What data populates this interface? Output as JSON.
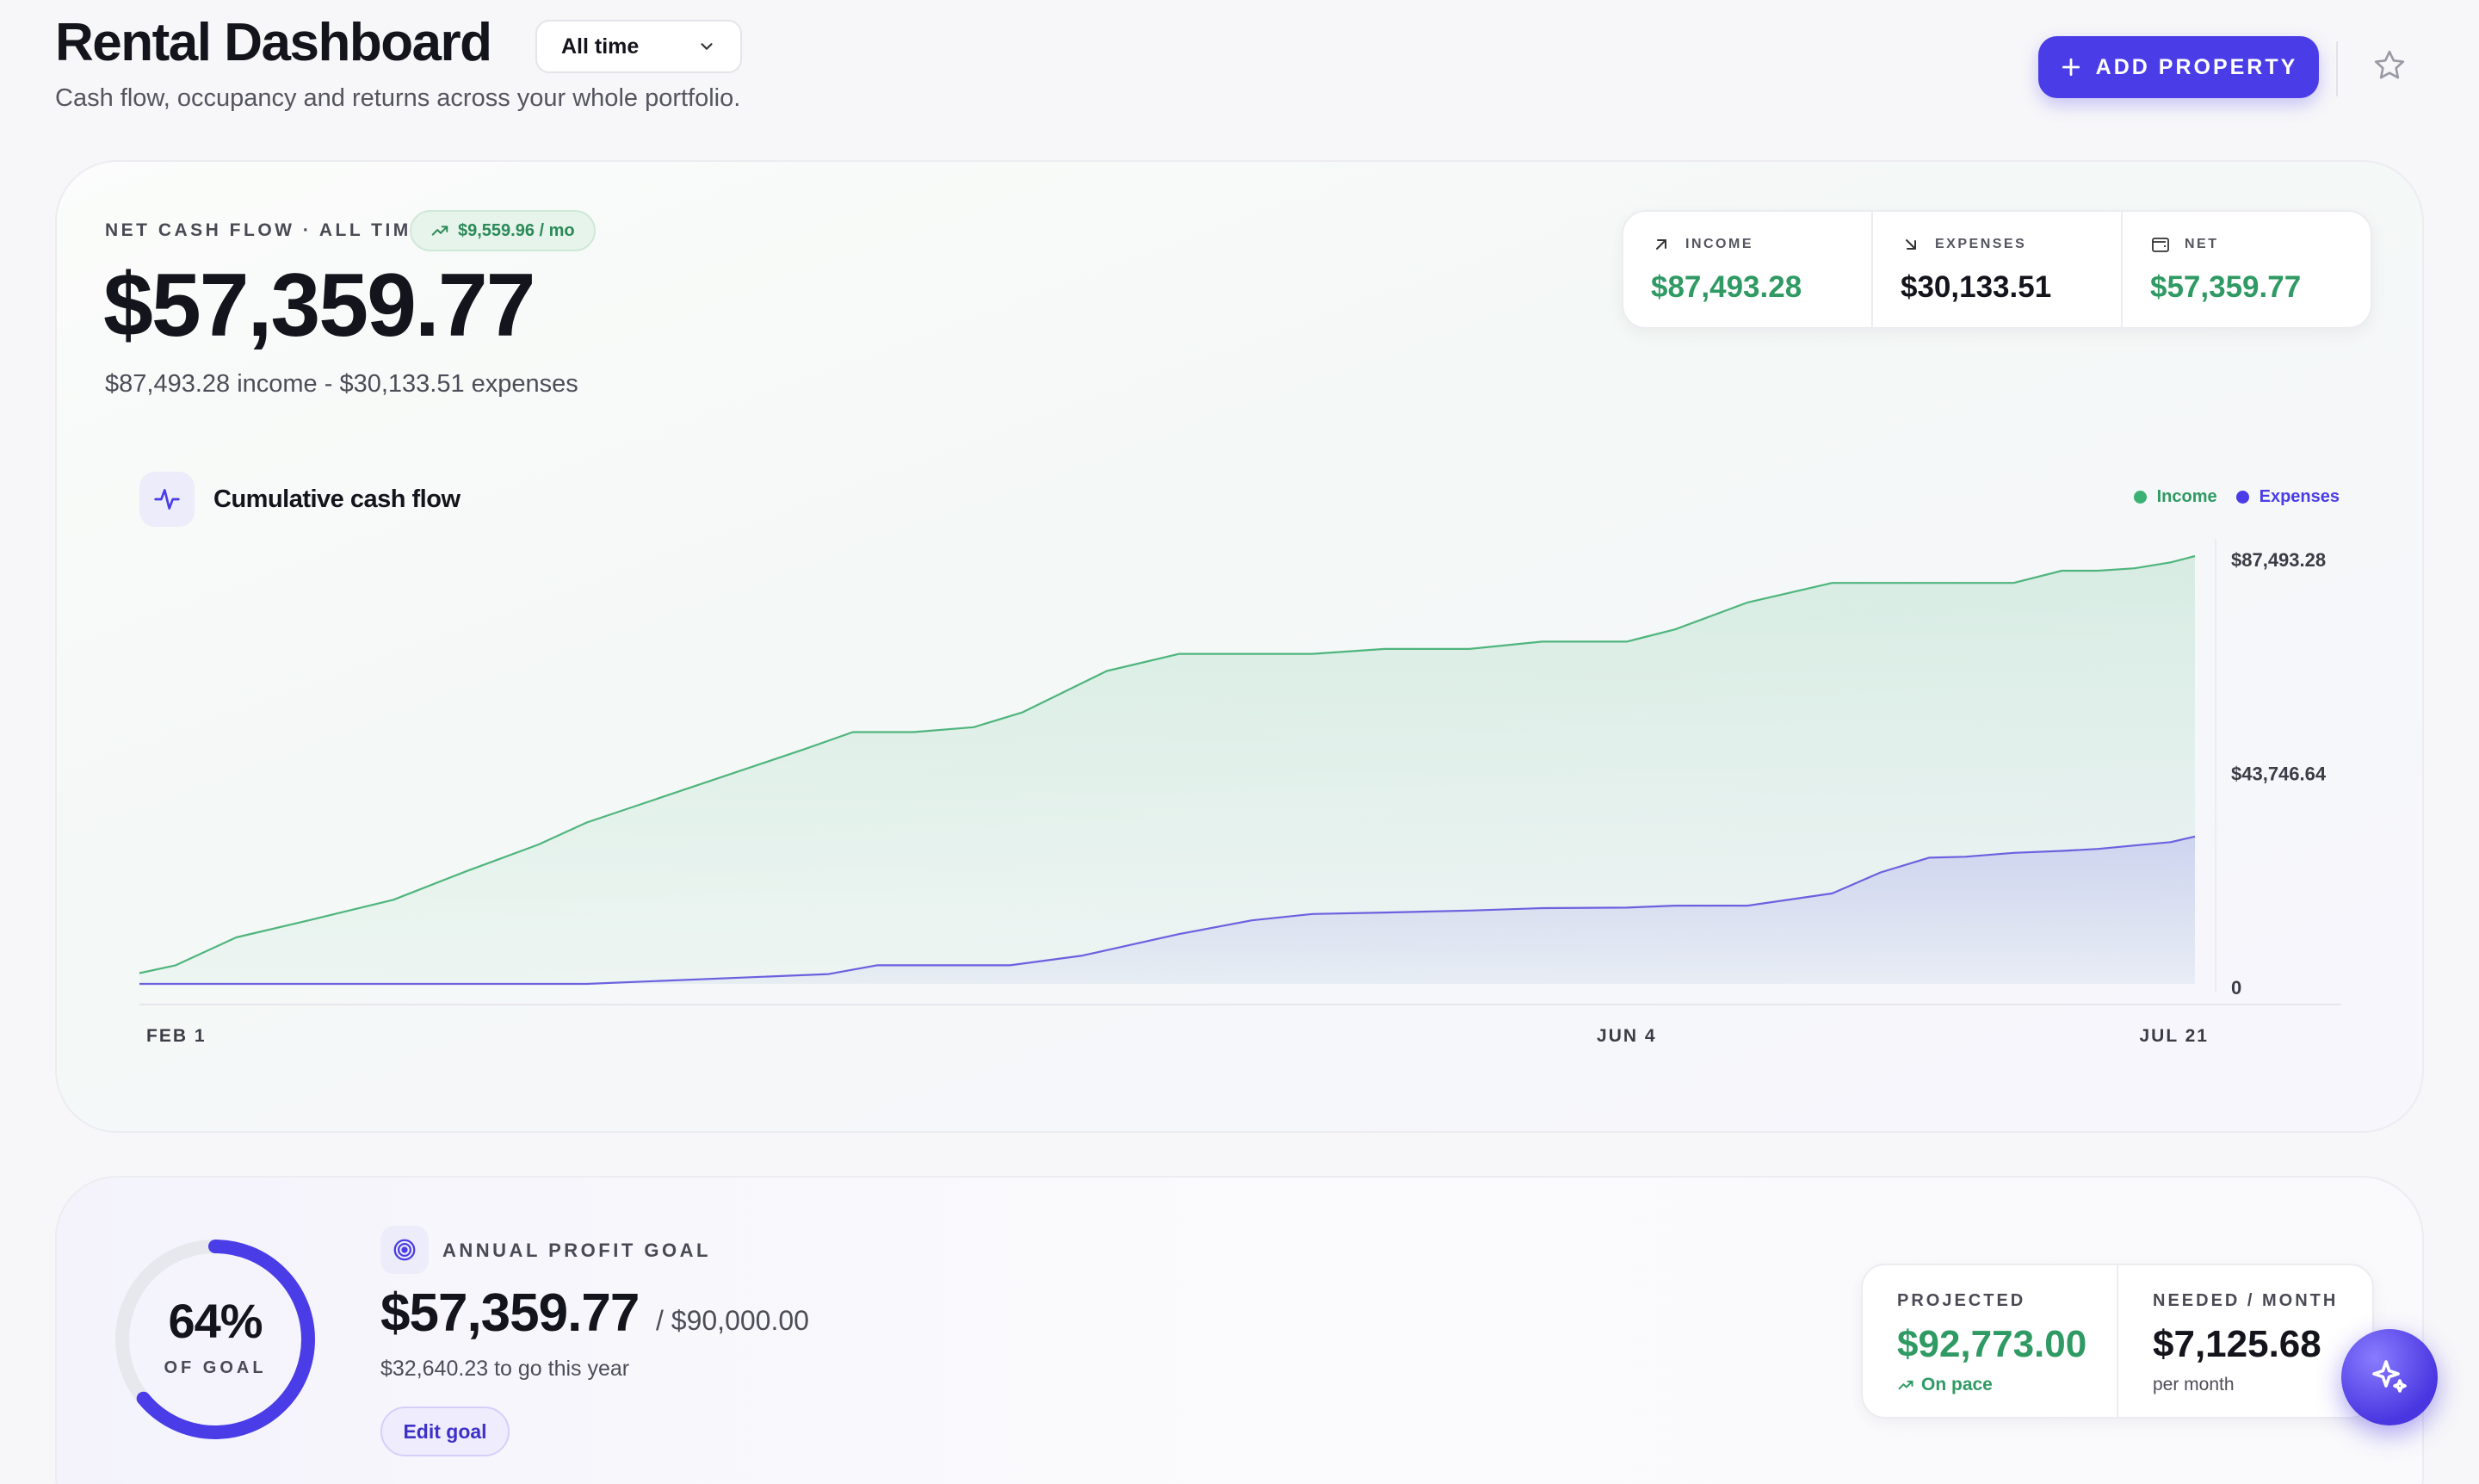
{
  "header": {
    "title": "Rental Dashboard",
    "subtitle": "Cash flow, occupancy and returns across your whole portfolio.",
    "range_select": "All time",
    "add_button": "ADD PROPERTY"
  },
  "cash_flow": {
    "eyebrow": "NET CASH FLOW · ALL TIME",
    "monthly_pill": "$9,559.96 / mo",
    "net_total": "$57,359.77",
    "detail": "$87,493.28 income - $30,133.51 expenses",
    "stats": [
      {
        "label": "INCOME",
        "value": "$87,493.28",
        "icon": "arrow-up-right-icon",
        "color": "#2f9a63"
      },
      {
        "label": "EXPENSES",
        "value": "$30,133.51",
        "icon": "arrow-down-right-icon",
        "color": "#14141c"
      },
      {
        "label": "NET",
        "value": "$57,359.77",
        "icon": "wallet-icon",
        "color": "#2f9a63"
      }
    ]
  },
  "chart": {
    "title": "Cumulative cash flow",
    "legend": [
      {
        "name": "Income",
        "color": "#3bb273"
      },
      {
        "name": "Expenses",
        "color": "#4a3de8"
      }
    ],
    "y_ticks": [
      "$87,493.28",
      "$43,746.64",
      "0"
    ],
    "x_ticks": [
      "FEB 1",
      "JUN 4",
      "JUL 21"
    ]
  },
  "chart_data": {
    "type": "area",
    "title": "Cumulative cash flow",
    "xlabel": "",
    "ylabel": "",
    "x_ticks": [
      "FEB 1",
      "JUN 4",
      "JUL 21"
    ],
    "ylim": [
      0,
      87493.28
    ],
    "y_ticks": [
      0,
      43746.64,
      87493.28
    ],
    "legend_position": "top-right",
    "grid": false,
    "series": [
      {
        "name": "Income",
        "color": "#3bb273",
        "x": [
          "Feb 1",
          "Feb 4",
          "Feb 9",
          "Feb 15",
          "Feb 22",
          "Feb 28",
          "Mar 6",
          "Mar 10",
          "Mar 16",
          "Mar 22",
          "Mar 28",
          "Apr 1",
          "Apr 6",
          "Apr 11",
          "Apr 15",
          "Apr 22",
          "Apr 28",
          "May 4",
          "May 9",
          "May 15",
          "May 22",
          "May 28",
          "Jun 4",
          "Jun 8",
          "Jun 14",
          "Jun 21",
          "Jun 25",
          "Jun 29",
          "Jul 2",
          "Jul 6",
          "Jul 10",
          "Jul 13",
          "Jul 16",
          "Jul 19",
          "Jul 21"
        ],
        "values": [
          2200,
          3800,
          9500,
          13000,
          17200,
          23000,
          28500,
          33000,
          38000,
          43000,
          48000,
          51500,
          51500,
          52500,
          55500,
          64000,
          67500,
          67500,
          67500,
          68500,
          68500,
          70000,
          70000,
          72500,
          78000,
          82000,
          82000,
          82000,
          82000,
          82000,
          84500,
          84500,
          85000,
          86200,
          87493.28
        ]
      },
      {
        "name": "Expenses",
        "color": "#4a3de8",
        "x": [
          "Feb 1",
          "Mar 10",
          "Mar 30",
          "Apr 3",
          "Apr 14",
          "Apr 20",
          "Apr 28",
          "May 4",
          "May 9",
          "May 15",
          "May 22",
          "May 28",
          "Jun 4",
          "Jun 8",
          "Jun 14",
          "Jun 21",
          "Jun 25",
          "Jun 29",
          "Jul 2",
          "Jul 6",
          "Jul 10",
          "Jul 13",
          "Jul 16",
          "Jul 19",
          "Jul 21"
        ],
        "values": [
          0,
          0,
          2000,
          3800,
          3800,
          5800,
          10200,
          13000,
          14300,
          14600,
          15000,
          15500,
          15600,
          16000,
          16000,
          18500,
          22800,
          25800,
          26000,
          26800,
          27200,
          27600,
          28300,
          29000,
          30133.51
        ]
      }
    ]
  },
  "goal": {
    "eyebrow": "ANNUAL PROFIT GOAL",
    "percent": "64%",
    "percent_value": 0.64,
    "of_goal": "OF GOAL",
    "current": "$57,359.77",
    "target": "/ $90,000.00",
    "to_go": "$32,640.23 to go this year",
    "edit_button": "Edit goal",
    "projected_label": "PROJECTED",
    "projected_value": "$92,773.00",
    "projected_status": "On pace",
    "needed_label": "NEEDED / MONTH",
    "needed_value": "$7,125.68",
    "needed_sub": "per month"
  },
  "colors": {
    "accent": "#4a3de8",
    "income": "#3bb273",
    "positive_text": "#2f9a63"
  }
}
